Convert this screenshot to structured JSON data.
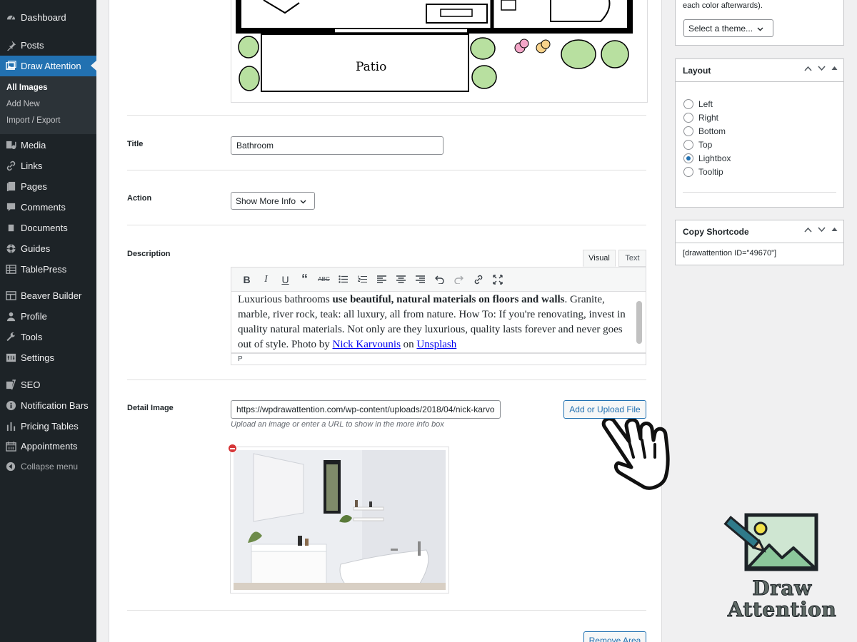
{
  "sidebar": {
    "items": [
      {
        "label": "Dashboard",
        "icon": "dashboard-icon"
      },
      {
        "label": "Posts",
        "icon": "pin-icon"
      },
      {
        "label": "Draw Attention",
        "icon": "images-icon"
      },
      {
        "label": "Media",
        "icon": "media-icon"
      },
      {
        "label": "Links",
        "icon": "link-icon"
      },
      {
        "label": "Pages",
        "icon": "pages-icon"
      },
      {
        "label": "Comments",
        "icon": "comment-icon"
      },
      {
        "label": "Documents",
        "icon": "document-icon"
      },
      {
        "label": "Guides",
        "icon": "lifebuoy-icon"
      },
      {
        "label": "TablePress",
        "icon": "table-icon"
      },
      {
        "label": "Beaver Builder",
        "icon": "layout-icon"
      },
      {
        "label": "Profile",
        "icon": "user-icon"
      },
      {
        "label": "Tools",
        "icon": "wrench-icon"
      },
      {
        "label": "Settings",
        "icon": "settings-icon"
      },
      {
        "label": "SEO",
        "icon": "seo-icon"
      },
      {
        "label": "Notification Bars",
        "icon": "info-icon"
      },
      {
        "label": "Pricing Tables",
        "icon": "bars-icon"
      },
      {
        "label": "Appointments",
        "icon": "calendar-icon"
      }
    ],
    "submenu": [
      "All Images",
      "Add New",
      "Import / Export"
    ],
    "collapse": "Collapse menu"
  },
  "floorplan": {
    "room_label": "Patio"
  },
  "fields": {
    "title_label": "Title",
    "title_value": "Bathroom",
    "action_label": "Action",
    "action_value": "Show More Info",
    "description_label": "Description",
    "detail_label": "Detail Image"
  },
  "editor": {
    "tab_visual": "Visual",
    "tab_text": "Text",
    "text_part1": "Luxurious bathrooms ",
    "text_bold": "use beautiful, natural materials on floors and walls",
    "text_part2": ". Granite, marble, river rock, teak: all luxury, all from nature. How To: If you're renovating, invest in quality natural materials. Not only are they luxurious, quality lasts forever and never goes out of style. Photo by ",
    "link1": "Nick Karvounis",
    "text_on": " on ",
    "link2": "Unsplash",
    "status": "P"
  },
  "detail": {
    "url": "https://wpdrawattention.com/wp-content/uploads/2018/04/nick-karvounis-bathroom.jpg",
    "upload_button": "Add or Upload File",
    "hint": "Upload an image or enter a URL to show in the more info box"
  },
  "remove_area": "Remove Area",
  "right": {
    "theme_note": "each color afterwards).",
    "theme_select": "Select a theme...",
    "layout_title": "Layout",
    "layout_options": [
      "Left",
      "Right",
      "Bottom",
      "Top",
      "Lightbox",
      "Tooltip"
    ],
    "layout_selected": "Lightbox",
    "shortcode_title": "Copy Shortcode",
    "shortcode": "[drawattention ID=\"49670\"]"
  },
  "brand": {
    "line1": "Draw",
    "line2": "Attention"
  },
  "colors": {
    "accent": "#2271b1",
    "sidebar": "#1d2327",
    "submenu": "#2c3338"
  }
}
